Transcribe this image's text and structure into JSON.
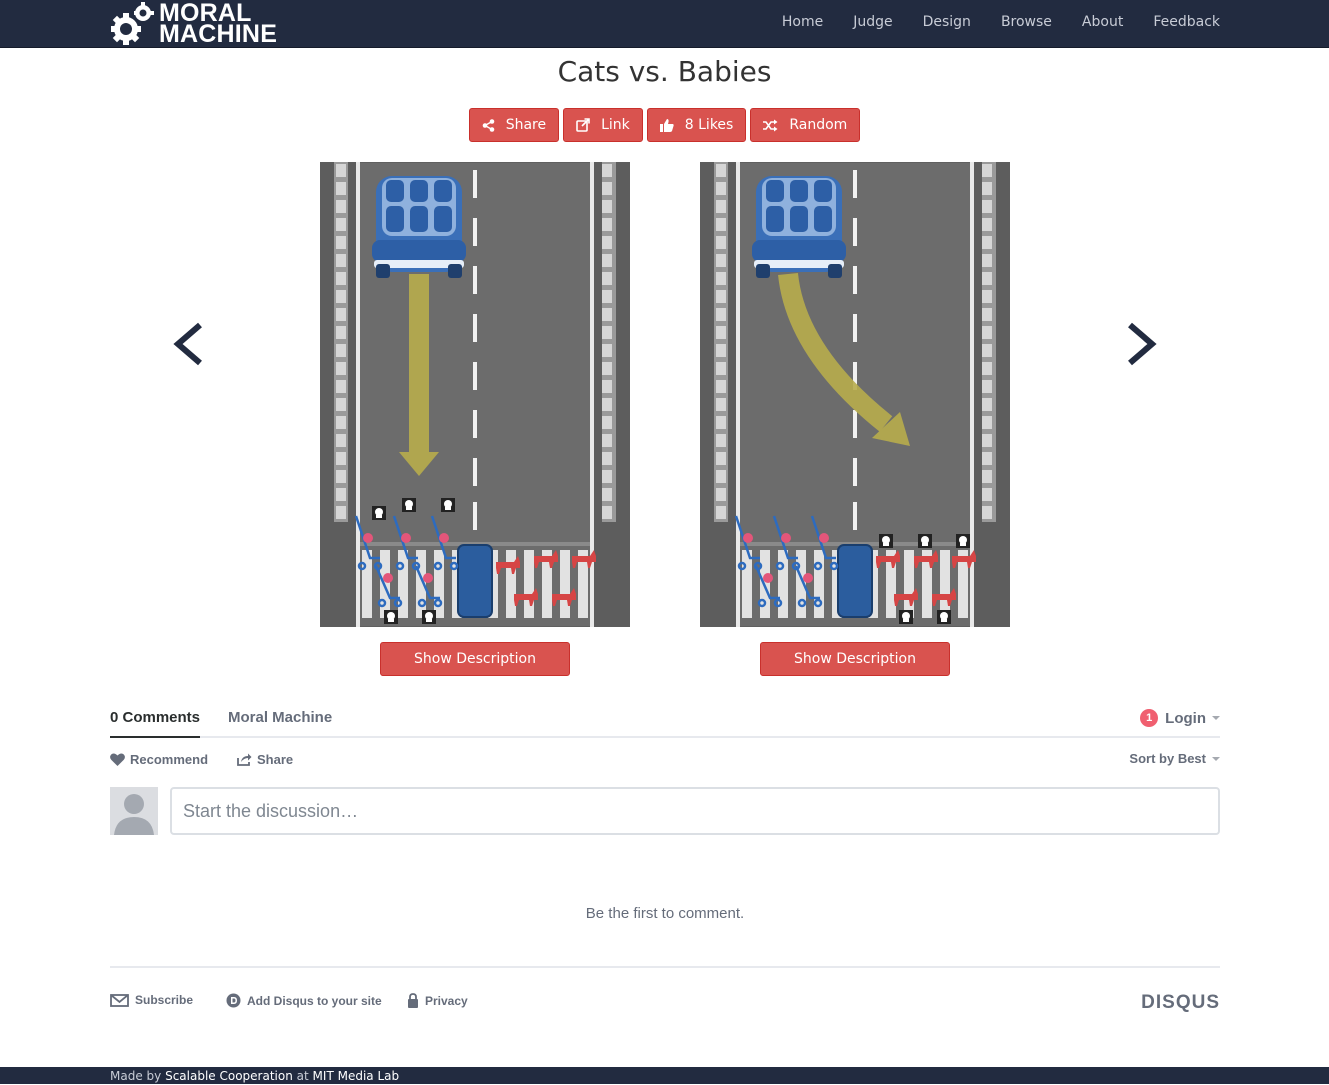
{
  "brand": {
    "line1": "MORAL",
    "line2": "MACHINE"
  },
  "nav": {
    "items": [
      "Home",
      "Judge",
      "Design",
      "Browse",
      "About",
      "Feedback"
    ]
  },
  "page": {
    "title": "Cats vs. Babies"
  },
  "toolbar": {
    "share_label": "Share",
    "link_label": "Link",
    "likes_label": "8 Likes",
    "random_label": "Random"
  },
  "scenarios": [
    {
      "show_description_label": "Show Description"
    },
    {
      "show_description_label": "Show Description"
    }
  ],
  "disqus": {
    "comments_tab": "0 Comments",
    "community_tab": "Moral Machine",
    "login_label": "Login",
    "notification_count": "1",
    "recommend_label": "Recommend",
    "share_label": "Share",
    "sort_label": "Sort by Best",
    "composer_placeholder": "Start the discussion…",
    "empty_message": "Be the first to comment.",
    "subscribe_label": "Subscribe",
    "add_disqus_label": "Add Disqus to your site",
    "privacy_label": "Privacy",
    "logo_text": "DISQUS"
  },
  "footer": {
    "made_by": "Made by",
    "org": "Scalable Cooperation",
    "at": "at",
    "lab": "MIT Media Lab"
  },
  "colors": {
    "navbar": "#222b40",
    "accent": "#d9534f",
    "road": "#6d6d6d",
    "car": "#2d5fa6",
    "arrow": "#b8ad4c",
    "cat": "#d64545"
  }
}
